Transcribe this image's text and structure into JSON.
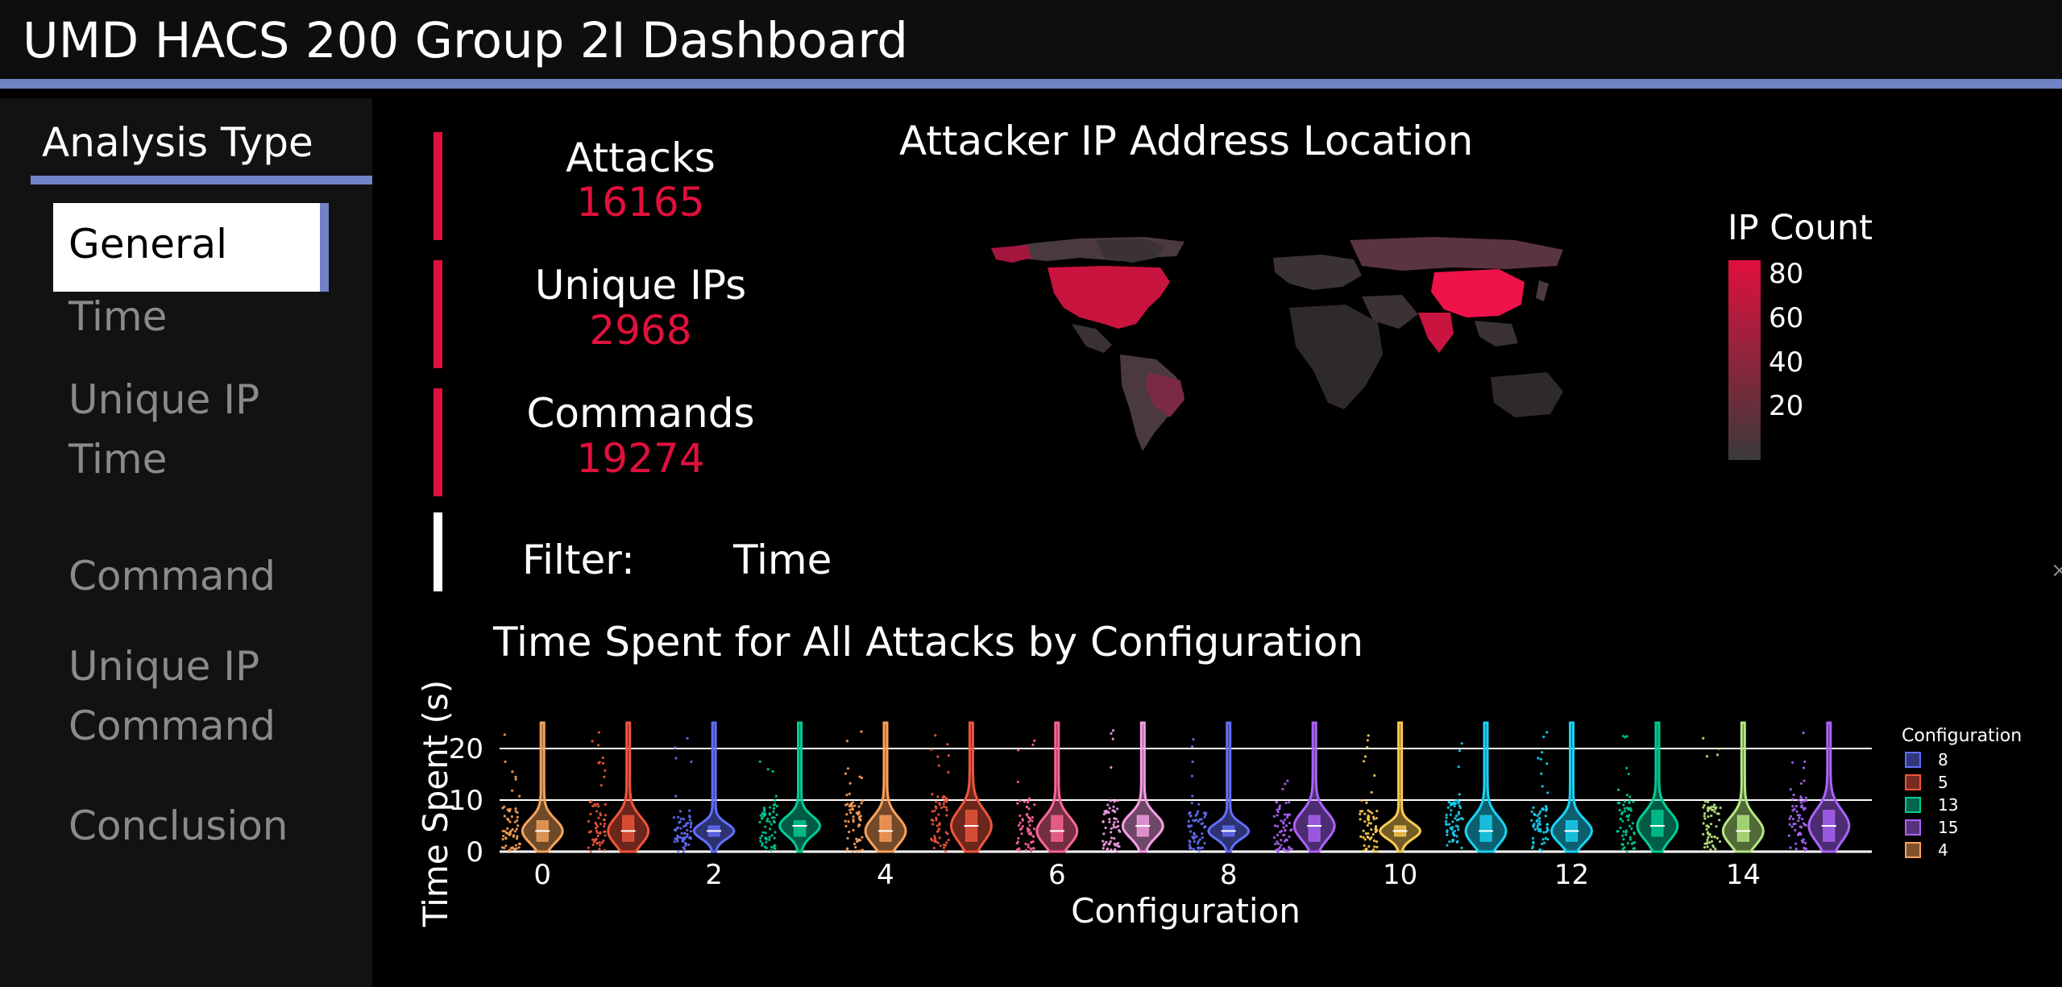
{
  "header": {
    "title": "UMD HACS 200 Group 2I Dashboard"
  },
  "sidebar": {
    "title": "Analysis Type",
    "items": [
      {
        "label": "General",
        "active": true
      },
      {
        "label": "Time"
      },
      {
        "label": "Unique IP Time"
      },
      {
        "label": "Command"
      },
      {
        "label": "Unique IP Command"
      },
      {
        "label": "Conclusion"
      }
    ]
  },
  "kpis": [
    {
      "label": "Attacks",
      "value": "16165"
    },
    {
      "label": "Unique IPs",
      "value": "2968"
    },
    {
      "label": "Commands",
      "value": "19274"
    }
  ],
  "filter": {
    "label": "Filter:",
    "value": "Time"
  },
  "colors": {
    "accent": "#7183c4",
    "kpi": "#e0103d",
    "background": "#000000"
  },
  "map": {
    "title": "Attacker IP Address Location",
    "colorbar_title": "IP Count",
    "colorbar_ticks": [
      "80",
      "60",
      "40",
      "20"
    ],
    "colorscale": [
      "#3a3a3a",
      "#e0103d"
    ]
  },
  "chart_data": {
    "type": "violin",
    "title": "Time Spent for All Attacks by Configuration",
    "xlabel": "Configuration",
    "ylabel": "Time Spent (s)",
    "xlim": [
      -0.5,
      15.5
    ],
    "ylim": [
      0,
      25
    ],
    "x_ticks": [
      "0",
      "2",
      "4",
      "6",
      "8",
      "10",
      "12",
      "14"
    ],
    "y_ticks": [
      "0",
      "10",
      "20"
    ],
    "grid": "horizontal",
    "legend_title": "Configuration",
    "legend_entries": [
      "8",
      "5",
      "13",
      "15",
      "4"
    ],
    "legend_placement": "right",
    "points": "all",
    "series": [
      {
        "name": "0",
        "median": 4,
        "q1": 2,
        "q3": 6,
        "max": 25,
        "color": "#f6a35b"
      },
      {
        "name": "1",
        "median": 4,
        "q1": 2,
        "q3": 7,
        "max": 25,
        "color": "#ef553b"
      },
      {
        "name": "2",
        "median": 4,
        "q1": 3,
        "q3": 5,
        "max": 25,
        "color": "#636efa"
      },
      {
        "name": "3",
        "median": 5,
        "q1": 3,
        "q3": 6,
        "max": 25,
        "color": "#00cc96"
      },
      {
        "name": "4",
        "median": 4,
        "q1": 2,
        "q3": 7,
        "max": 25,
        "color": "#ffa15a"
      },
      {
        "name": "5",
        "median": 5,
        "q1": 2,
        "q3": 8,
        "max": 25,
        "color": "#ef553b"
      },
      {
        "name": "6",
        "median": 4,
        "q1": 2,
        "q3": 7,
        "max": 25,
        "color": "#ff6692"
      },
      {
        "name": "7",
        "median": 5,
        "q1": 3,
        "q3": 7,
        "max": 25,
        "color": "#f79fe6"
      },
      {
        "name": "8",
        "median": 4,
        "q1": 3,
        "q3": 5,
        "max": 25,
        "color": "#636efa"
      },
      {
        "name": "9",
        "median": 5,
        "q1": 2,
        "q3": 7,
        "max": 25,
        "color": "#ab63fa"
      },
      {
        "name": "10",
        "median": 4,
        "q1": 3,
        "q3": 5,
        "max": 25,
        "color": "#fecb52"
      },
      {
        "name": "11",
        "median": 4,
        "q1": 2,
        "q3": 7,
        "max": 25,
        "color": "#19d3f3"
      },
      {
        "name": "12",
        "median": 4,
        "q1": 2,
        "q3": 6,
        "max": 25,
        "color": "#19d3f3"
      },
      {
        "name": "13",
        "median": 5,
        "q1": 3,
        "q3": 8,
        "max": 25,
        "color": "#00cc96"
      },
      {
        "name": "14",
        "median": 4,
        "q1": 2,
        "q3": 7,
        "max": 25,
        "color": "#b6e880"
      },
      {
        "name": "15",
        "median": 5,
        "q1": 2,
        "q3": 8,
        "max": 25,
        "color": "#ab63fa"
      }
    ]
  }
}
